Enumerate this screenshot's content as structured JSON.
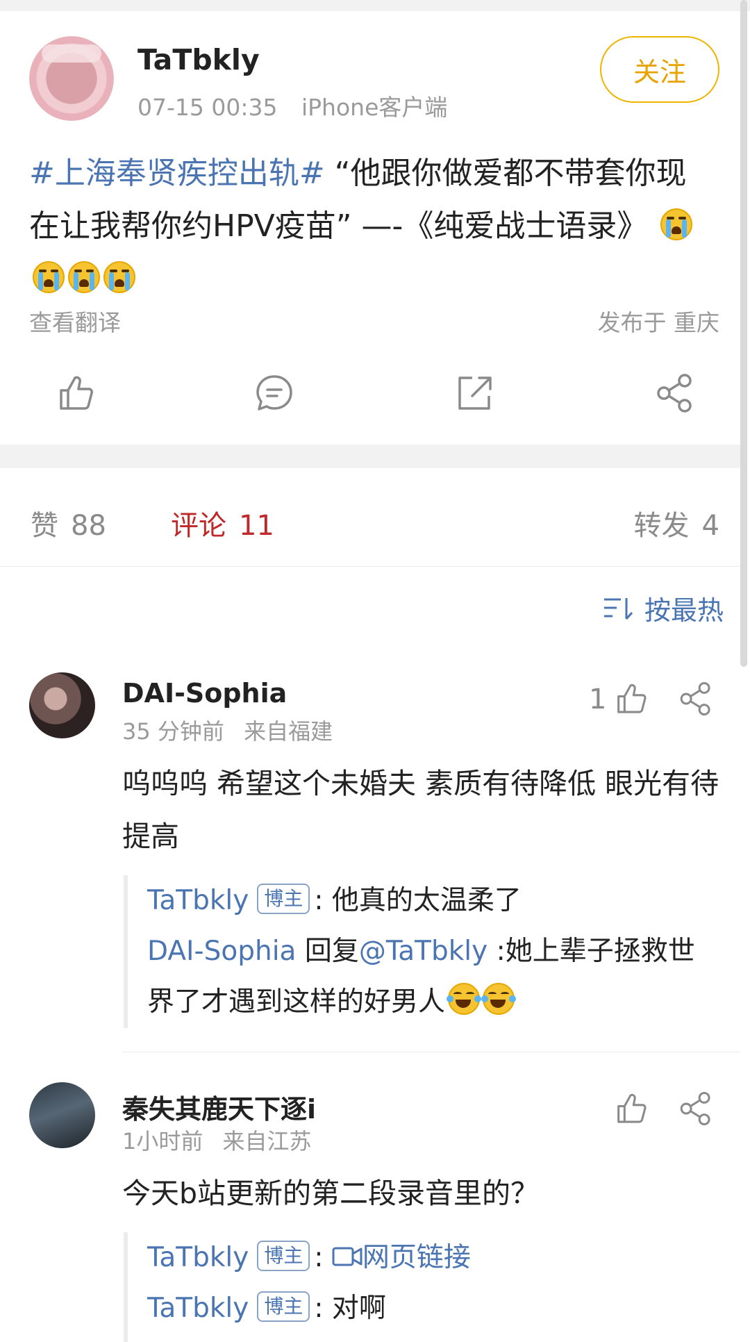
{
  "post": {
    "author": "TaTbkly",
    "time": "07-15 00:35",
    "client": "iPhone客户端",
    "follow_label": "关注",
    "topic": "#上海奉贤疾控出轨#",
    "text": " “他跟你做爱都不带套你现在让我帮你约HPV疫苗” —-《纯爱战士语录》",
    "emoji": "crying-face",
    "translate_label": "查看翻译",
    "location_label": "发布于 重庆"
  },
  "stats": {
    "like_label": "赞",
    "like_count": "88",
    "comment_label": "评论",
    "comment_count": "11",
    "repost_label": "转发",
    "repost_count": "4"
  },
  "sort": {
    "label": "按最热"
  },
  "comments": [
    {
      "name": "DAI-Sophia",
      "time": "35 分钟前",
      "from": "来自福建",
      "text": "呜呜呜 希望这个未婚夫 素质有待降低 眼光有待提高",
      "like_count": "1",
      "replies": [
        {
          "name": "TaTbkly",
          "badge": "博主",
          "sep": ":",
          "text": "他真的太温柔了"
        },
        {
          "name": "DAI-Sophia",
          "reply_word": "回复",
          "at": "@TaTbkly",
          "sep": ":",
          "text": "她上辈子拯救世界了才遇到这样的好男人"
        }
      ]
    },
    {
      "name": "秦失其鹿天下逐i",
      "time": "1小时前",
      "from": "来自江苏",
      "text": "今天b站更新的第二段录音里的？",
      "like_count": "",
      "replies": [
        {
          "name": "TaTbkly",
          "badge": "博主",
          "sep": ":",
          "link": "网页链接"
        },
        {
          "name": "TaTbkly",
          "badge": "博主",
          "sep": ":",
          "text": "对啊"
        }
      ]
    }
  ],
  "colors": {
    "link_blue": "#4b75b2",
    "follow_gold": "#e9a300",
    "comment_red": "#c0292b",
    "meta_gray": "#9a9a9a"
  }
}
